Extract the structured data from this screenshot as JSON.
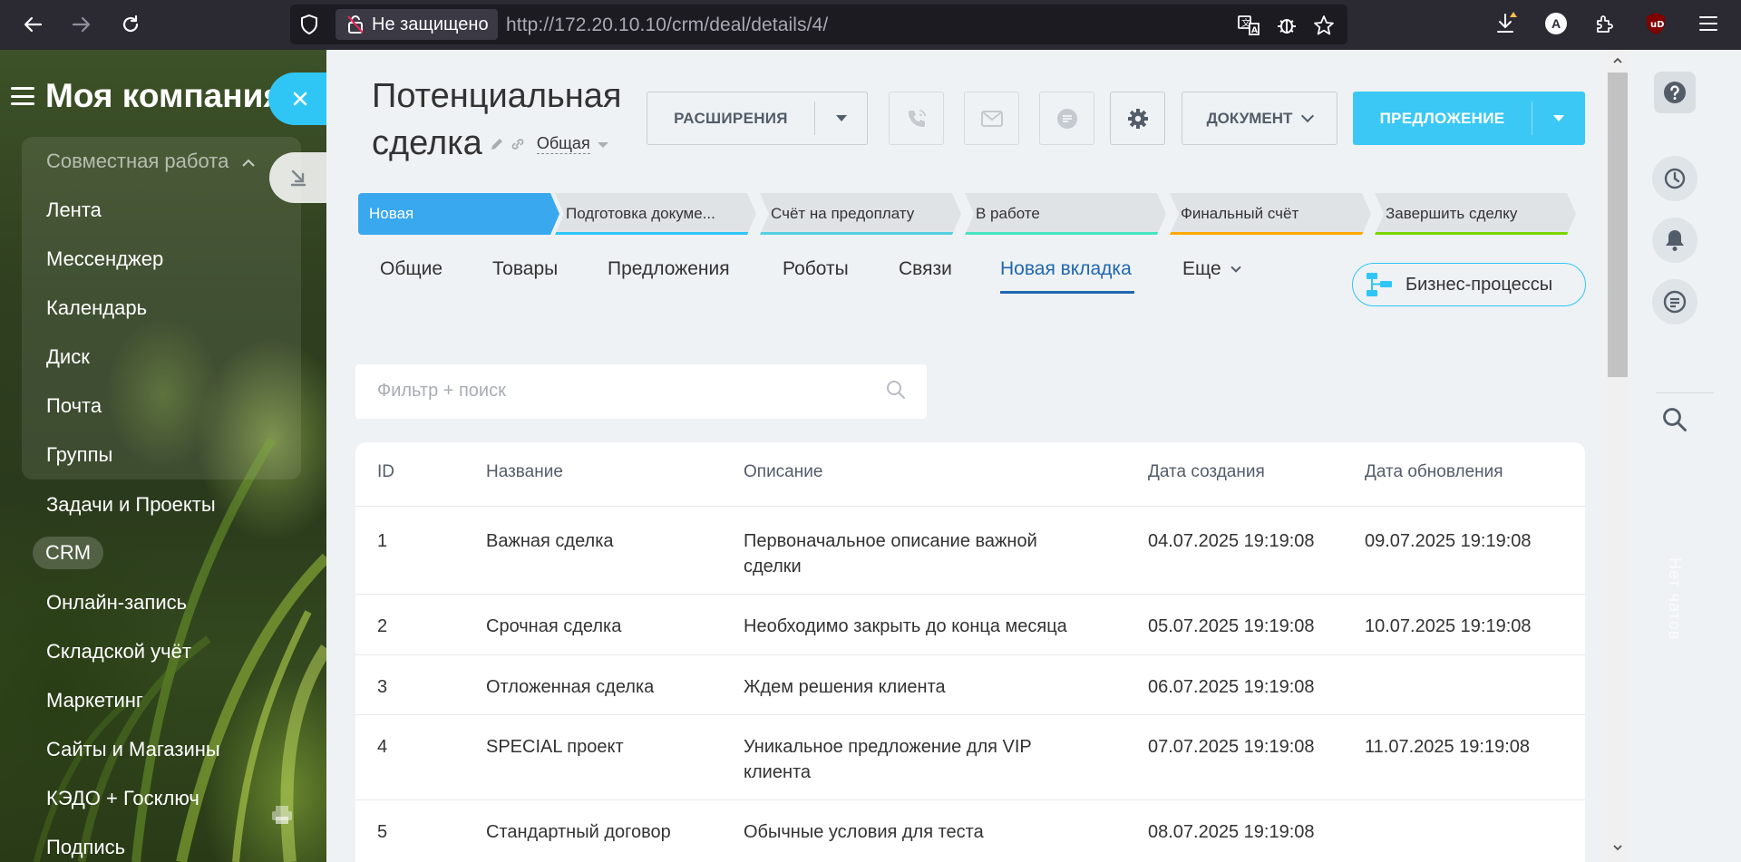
{
  "browser": {
    "security_label": "Не защищено",
    "url": "http://172.20.10.10/crm/deal/details/4/",
    "profile_initial": "A"
  },
  "sidebar": {
    "company": "Моя компания",
    "group_title": "Совместная работа",
    "group_items": [
      "Лента",
      "Мессенджер",
      "Календарь",
      "Диск",
      "Почта",
      "Группы"
    ],
    "items": [
      "Задачи и Проекты",
      "CRM",
      "Онлайн-запись",
      "Складской учёт",
      "Маркетинг",
      "Сайты и Магазины",
      "КЭДО + Госключ",
      "Подпись"
    ]
  },
  "deal": {
    "title_line1": "Потенциальная",
    "title_line2": "сделка",
    "category": "Общая"
  },
  "toolbar": {
    "extensions_label": "РАСШИРЕНИЯ",
    "document_label": "ДОКУМЕНТ",
    "offer_label": "ПРЕДЛОЖЕНИЕ"
  },
  "stages": [
    {
      "label": "Новая",
      "color": "#39a8ef"
    },
    {
      "label": "Подготовка докуме...",
      "color": "#2fc6f6"
    },
    {
      "label": "Счёт на предоплату",
      "color": "#55d0e0"
    },
    {
      "label": "В работе",
      "color": "#47e4c2"
    },
    {
      "label": "Финальный счёт",
      "color": "#ffa900"
    },
    {
      "label": "Завершить сделку",
      "color": "#7bd500"
    }
  ],
  "tabs": [
    "Общие",
    "Товары",
    "Предложения",
    "Роботы",
    "Связи",
    "Новая вкладка",
    "Еще"
  ],
  "active_tab": "Новая вкладка",
  "bp_button": "Бизнес-процессы",
  "filter": {
    "placeholder": "Фильтр + поиск"
  },
  "table": {
    "headers": [
      "ID",
      "Название",
      "Описание",
      "Дата создания",
      "Дата обновления"
    ],
    "rows": [
      {
        "id": "1",
        "name": "Важная сделка",
        "desc_line1": "Первоначальное описание важной",
        "desc_line2": "сделки",
        "created": "04.07.2025 19:19:08",
        "updated": "09.07.2025 19:19:08"
      },
      {
        "id": "2",
        "name": "Срочная сделка",
        "desc_line1": "Необходимо закрыть до конца месяца",
        "desc_line2": "",
        "created": "05.07.2025 19:19:08",
        "updated": "10.07.2025 19:19:08"
      },
      {
        "id": "3",
        "name": "Отложенная сделка",
        "desc_line1": "Ждем решения клиента",
        "desc_line2": "",
        "created": "06.07.2025 19:19:08",
        "updated": ""
      },
      {
        "id": "4",
        "name": "SPECIAL проект",
        "desc_line1": "Уникальное предложение для VIP",
        "desc_line2": "клиента",
        "created": "07.07.2025 19:19:08",
        "updated": "11.07.2025 19:19:08"
      },
      {
        "id": "5",
        "name": "Стандартный договор",
        "desc_line1": "Обычные условия для теста",
        "desc_line2": "",
        "created": "08.07.2025 19:19:08",
        "updated": ""
      }
    ]
  },
  "right_panel": {
    "vertical_text": "Нет чатов"
  }
}
